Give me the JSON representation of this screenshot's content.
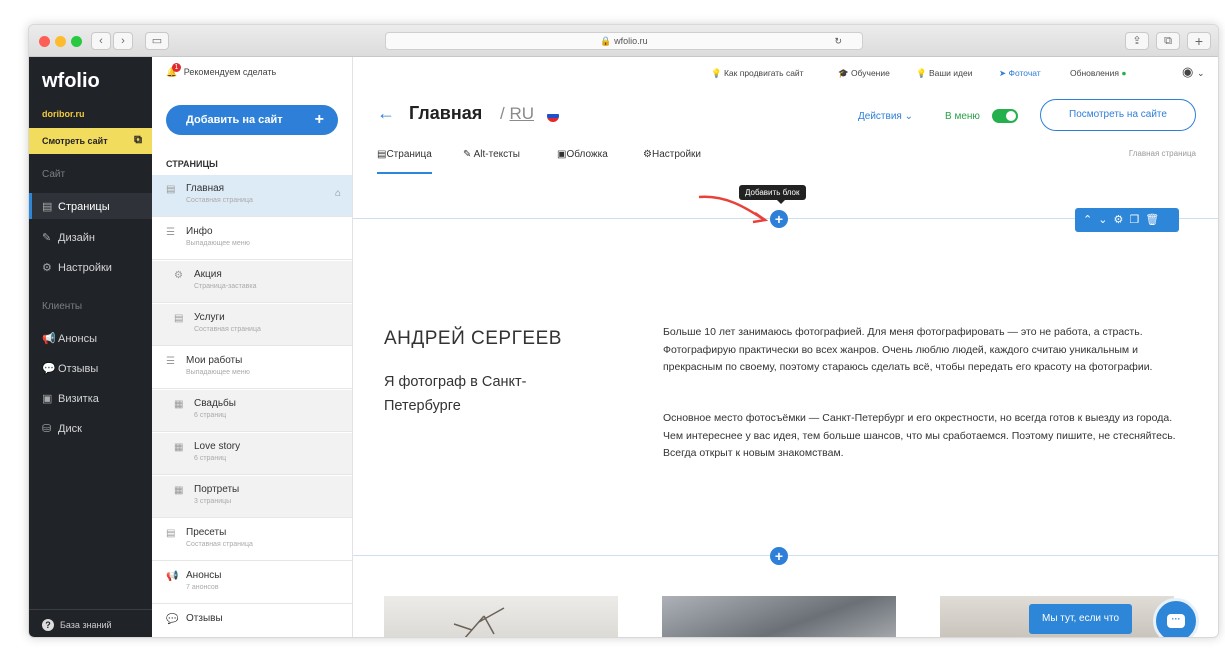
{
  "browser": {
    "url": "wfolio.ru"
  },
  "sidebar": {
    "logo": "wfolio",
    "site_name": "doribor.ru",
    "view_site": "Смотреть сайт",
    "section_site": "Сайт",
    "section_clients": "Клиенты",
    "items": [
      {
        "label": "Страницы",
        "icon": "pages-icon",
        "active": true
      },
      {
        "label": "Дизайн",
        "icon": "brush-icon"
      },
      {
        "label": "Настройки",
        "icon": "gear-icon"
      }
    ],
    "client_items": [
      {
        "label": "Анонсы",
        "icon": "megaphone-icon"
      },
      {
        "label": "Отзывы",
        "icon": "reviews-icon"
      },
      {
        "label": "Визитка",
        "icon": "card-icon"
      },
      {
        "label": "Диск",
        "icon": "disk-icon"
      }
    ],
    "knowledge_base": "База знаний"
  },
  "pages_panel": {
    "recommend": "Рекомендуем сделать",
    "recommend_count": "1",
    "add_button": "Добавить на сайт",
    "heading": "СТРАНИЦЫ",
    "rows": [
      {
        "title": "Главная",
        "subtitle": "Составная страница",
        "selected": true
      },
      {
        "title": "Инфо",
        "subtitle": "Выпадающее меню"
      },
      {
        "title": "Акция",
        "subtitle": "Страница-заставка",
        "sub": true
      },
      {
        "title": "Услуги",
        "subtitle": "Составная страница",
        "sub": true
      },
      {
        "title": "Мои работы",
        "subtitle": "Выпадающее меню"
      },
      {
        "title": "Свадьбы",
        "subtitle": "6 страниц",
        "sub": true
      },
      {
        "title": "Love story",
        "subtitle": "6 страниц",
        "sub": true
      },
      {
        "title": "Портреты",
        "subtitle": "3 страницы",
        "sub": true
      },
      {
        "title": "Пресеты",
        "subtitle": "Составная страница"
      },
      {
        "title": "Анонсы",
        "subtitle": "7 анонсов"
      },
      {
        "title": "Отзывы",
        "subtitle": ""
      }
    ]
  },
  "topbar": {
    "promote": "Как продвигать сайт",
    "learning": "Обучение",
    "ideas": "Ваши идеи",
    "photochat": "Фоточат",
    "updates": "Обновления"
  },
  "page": {
    "title": "Главная",
    "lang": "RU",
    "actions": "Действия",
    "in_menu": "В меню",
    "in_menu_on": true,
    "view_on_site": "Посмотреть на сайте",
    "homepage_note": "Главная страница",
    "tabs": [
      "Страница",
      "Alt-тексты",
      "Обложка",
      "Настройки"
    ],
    "add_block_tooltip": "Добавить блок"
  },
  "content": {
    "name": "АНДРЕЙ СЕРГЕЕВ",
    "subtitle": "Я фотограф в Санкт-Петербурге",
    "paragraph1": "Больше 10 лет занимаюсь фотографией. Для меня фотографировать — это не работа, а страсть. Фотографирую практически во всех жанров. Очень люблю людей, каждого считаю уникальным и прекрасным по своему, поэтому стараюсь сделать всё, чтобы передать его красоту на фотографии.",
    "paragraph2": "Основное место фотосъёмки — Санкт-Петербург и его окрестности, но всегда готов к выезду из города. Чем интереснее у вас идея, тем больше шансов, что мы сработаемся. Поэтому пишите, не стесняйтесь. Всегда открыт к новым знакомствам."
  },
  "chat": {
    "label": "Мы тут, если что"
  },
  "colors": {
    "accent": "#2d7fd8",
    "sidebar": "#202328",
    "highlight": "#f2dc5d",
    "toggle_on": "#24b04c"
  }
}
